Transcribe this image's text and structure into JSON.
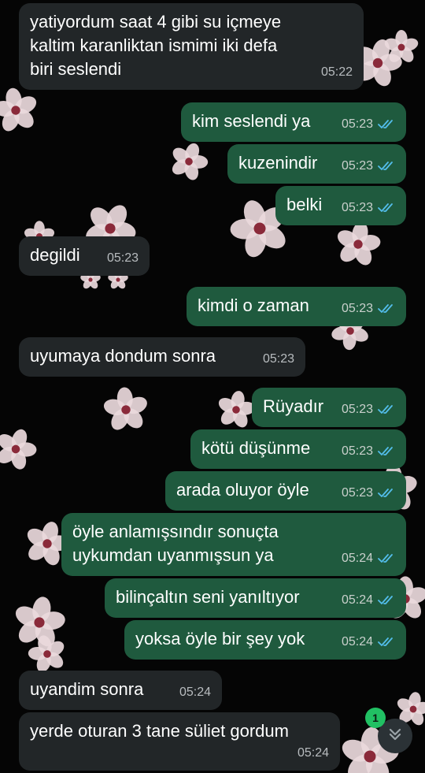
{
  "colors": {
    "incoming_bubble": "#222628",
    "outgoing_bubble": "#1f5a3e",
    "read_ticks": "#53bdeb",
    "badge": "#21c063",
    "background": "#050505"
  },
  "messages": [
    {
      "dir": "in",
      "text": "yatiyordum saat 4 gibi su içmeye\nkaltim karanliktan ismimi iki defa\nbiri seslendi",
      "time": "05:22"
    },
    {
      "dir": "out",
      "text": "kim seslendi ya",
      "time": "05:23",
      "status": "read"
    },
    {
      "dir": "out",
      "text": "kuzenindir",
      "time": "05:23",
      "status": "read"
    },
    {
      "dir": "out",
      "text": "belki",
      "time": "05:23",
      "status": "read"
    },
    {
      "dir": "in",
      "text": "degildi",
      "time": "05:23"
    },
    {
      "dir": "out",
      "text": "kimdi o zaman",
      "time": "05:23",
      "status": "read"
    },
    {
      "dir": "in",
      "text": "uyumaya dondum sonra",
      "time": "05:23"
    },
    {
      "dir": "out",
      "text": "Rüyadır",
      "time": "05:23",
      "status": "read"
    },
    {
      "dir": "out",
      "text": "kötü düşünme",
      "time": "05:23",
      "status": "read"
    },
    {
      "dir": "out",
      "text": "arada oluyor öyle",
      "time": "05:23",
      "status": "read"
    },
    {
      "dir": "out",
      "text": "öyle anlamışsındır sonuçta\nuykumdan uyanmışsun ya",
      "time": "05:24",
      "status": "read"
    },
    {
      "dir": "out",
      "text": "bilinçaltın seni yanıltıyor",
      "time": "05:24",
      "status": "read"
    },
    {
      "dir": "out",
      "text": "yoksa öyle bir şey yok",
      "time": "05:24",
      "status": "read"
    },
    {
      "dir": "in",
      "text": "uyandim sonra",
      "time": "05:24"
    },
    {
      "dir": "in",
      "text": "yerde oturan 3 tane süliet gordum",
      "time": "05:24"
    }
  ],
  "scroll_button": {
    "icon": "double-chevron-down-icon",
    "unread_count": "1"
  },
  "wallpaper": {
    "icon": "cherry-blossom-icon"
  }
}
